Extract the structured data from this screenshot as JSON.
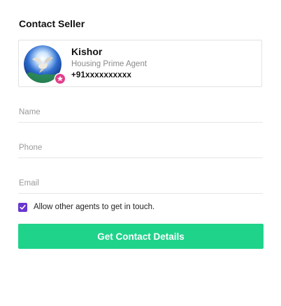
{
  "form": {
    "title": "Contact Seller",
    "fields": {
      "name_placeholder": "Name",
      "phone_placeholder": "Phone",
      "email_placeholder": "Email"
    },
    "consent": {
      "label": "Allow other agents to get in touch.",
      "checked": true
    },
    "submit_label": "Get Contact Details"
  },
  "agent": {
    "name": "Kishor",
    "role": "Housing Prime Agent",
    "phone": "+91xxxxxxxxxx",
    "avatar_icon": "dove-icon",
    "badge_icon": "prime-badge-icon"
  },
  "colors": {
    "accent": "#1fd38a",
    "checkbox": "#6a36d1",
    "badge": "#e23d8a"
  }
}
